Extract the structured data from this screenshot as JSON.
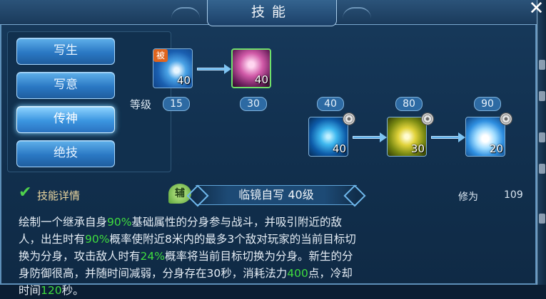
{
  "window": {
    "title": "技能",
    "close_label": "✕"
  },
  "categories": [
    {
      "label": "写生",
      "active": false
    },
    {
      "label": "写意",
      "active": false
    },
    {
      "label": "传神",
      "active": true
    },
    {
      "label": "绝技",
      "active": false
    }
  ],
  "tree": {
    "grade_label": "等级",
    "passive_badge": "被",
    "nodes": [
      {
        "icon": "water-wave-icon",
        "level": "40",
        "req": "15"
      },
      {
        "icon": "fairy-portrait-icon",
        "level": "40",
        "req": "30"
      },
      {
        "icon": "blue-figure-icon",
        "level": "40",
        "req": "40"
      },
      {
        "icon": "yellow-crystal-icon",
        "level": "30",
        "req": "80"
      },
      {
        "icon": "cloud-icon",
        "level": "20",
        "req": "90"
      }
    ]
  },
  "detail": {
    "header_label": "技能详情",
    "type_badge": "辅",
    "skill_name": "临镜自写 40级",
    "stat_label": "修为",
    "stat_value": "109",
    "desc": [
      {
        "t": "绘制一个继承自身"
      },
      {
        "t": "90%",
        "hl": true
      },
      {
        "t": "基础属性的分身参与战斗，并吸引附近的敌人，出生时有"
      },
      {
        "t": "90%",
        "hl": true
      },
      {
        "t": "概率使附近8米内的最多3个敌对玩家的当前目标切换为分身，攻击敌人时有"
      },
      {
        "t": "24%",
        "hl": true
      },
      {
        "t": "概率将当前目标切换为分身。新生的分身防御很高，并随时间减弱，分身存在30秒，消耗法力"
      },
      {
        "t": "400",
        "hl": true
      },
      {
        "t": "点，冷却时间"
      },
      {
        "t": "120",
        "hl": true
      },
      {
        "t": "秒。"
      }
    ]
  }
}
